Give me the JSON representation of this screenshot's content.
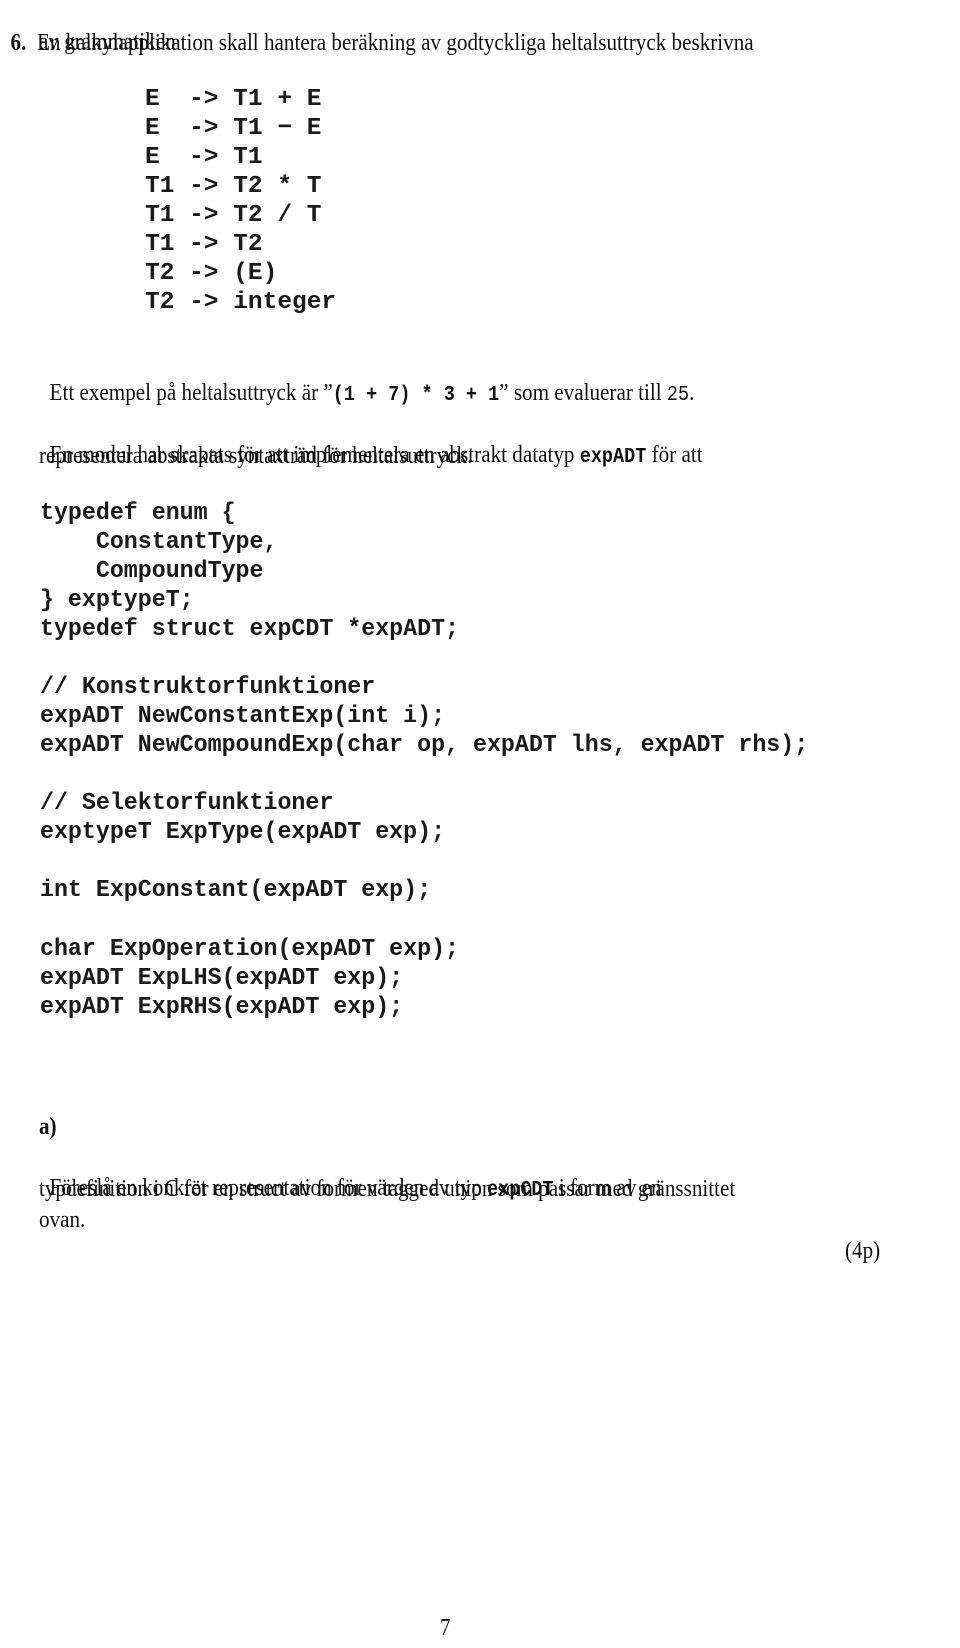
{
  "question": {
    "number": "6.",
    "intro_line1": "En kalkylapplikation skall hantera beräkning av godtyckliga heltalsuttryck beskrivna",
    "intro_line2": "av grammatiken"
  },
  "grammar": [
    "E  -> T1 + E",
    "E  -> T1 − E",
    "E  -> T1",
    "T1 -> T2 * T",
    "T1 -> T2 / T",
    "T1 -> T2",
    "T2 -> (E)",
    "T2 -> integer"
  ],
  "example": {
    "prefix": "Ett exempel på heltalsuttryck är ",
    "open_quote": "”",
    "expression": "(1 + 7) * 3 + 1",
    "close_quote": "”",
    "middle": " som evaluerar till ",
    "result": "25",
    "suffix": "."
  },
  "module": {
    "line1_prefix": "En modul har skapats för att implementera en abstrakt datatyp ",
    "line1_code": "expADT",
    "line1_suffix": " för att",
    "line2": "representera abstrakta syntaxträd för heltalsuttryck."
  },
  "code_block": [
    "typedef enum {",
    "    ConstantType,",
    "    CompoundType",
    "} exptypeT;",
    "typedef struct expCDT *expADT;",
    "",
    "// Konstruktorfunktioner",
    "expADT NewConstantExp(int i);",
    "expADT NewCompoundExp(char op, expADT lhs, expADT rhs);",
    "",
    "// Selektorfunktioner",
    "exptypeT ExpType(expADT exp);",
    "",
    "int ExpConstant(expADT exp);",
    "",
    "char ExpOperation(expADT exp);",
    "expADT ExpLHS(expADT exp);",
    "expADT ExpRHS(expADT exp);"
  ],
  "part_a": {
    "label": "a)",
    "line1_prefix": "Föreslå en konkret representation för värden av typ ",
    "line1_code": "expCDT",
    "line1_suffix": " i form av en",
    "line2": "typdefinition i C för en struct av formen tagged union som passar med gränssnittet",
    "line3": "ovan.",
    "points": "(4p)"
  },
  "page_number": "7"
}
